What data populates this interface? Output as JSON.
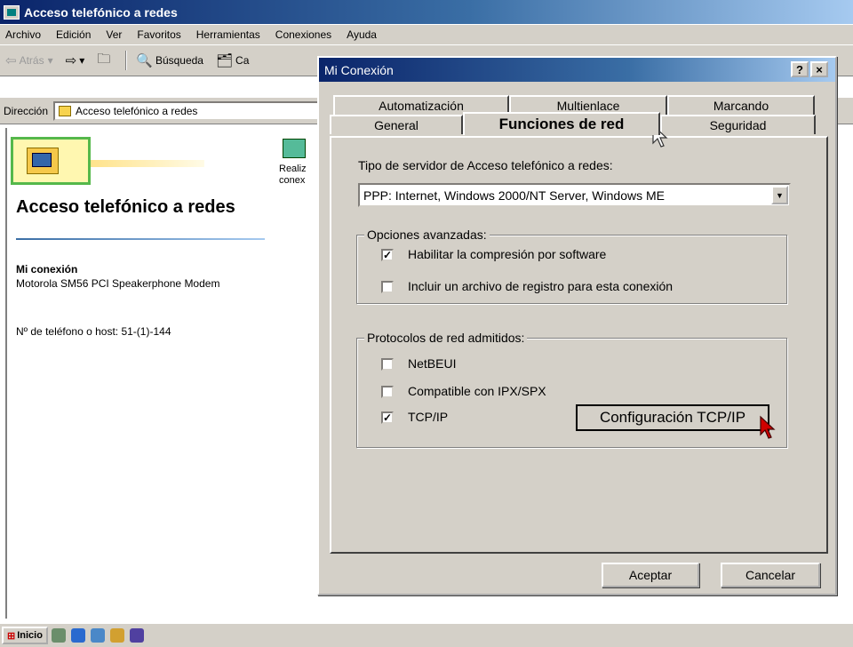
{
  "explorer": {
    "title": "Acceso telefónico a redes",
    "menu": [
      "Archivo",
      "Edición",
      "Ver",
      "Favoritos",
      "Herramientas",
      "Conexiones",
      "Ayuda"
    ],
    "toolbar": {
      "back": "Atrás",
      "search": "Búsqueda",
      "folders": "Ca"
    },
    "address_label": "Dirección",
    "address_value": "Acceso telefónico a redes",
    "side_title": "Acceso telefónico a redes",
    "connection_name": "Mi conexión",
    "modem": "Motorola SM56 PCI Speakerphone Modem",
    "phone": "Nº de teléfono o host: 51-(1)-144",
    "new_connection_text": "Realiz conex"
  },
  "taskbar": {
    "start_label": "Inicio"
  },
  "dialog": {
    "title": "Mi Conexión",
    "help_btn": "?",
    "close_btn": "×",
    "tabs_back": [
      "Automatización",
      "Multienlace",
      "Marcando"
    ],
    "tabs_front": [
      "General",
      "Funciones de red",
      "Seguridad"
    ],
    "active_tab": "Funciones de red",
    "server_type_label": "Tipo de servidor de Acceso telefónico a redes:",
    "server_type_value": "PPP: Internet, Windows 2000/NT Server, Windows ME",
    "advanced_group": "Opciones avanzadas:",
    "adv_compression": "Habilitar la compresión por software",
    "adv_compression_checked": true,
    "adv_log": "Incluir un archivo de registro para esta conexión",
    "adv_log_checked": false,
    "protocols_group": "Protocolos de red admitidos:",
    "proto_netbeui": "NetBEUI",
    "proto_netbeui_checked": false,
    "proto_ipx": "Compatible con IPX/SPX",
    "proto_ipx_checked": false,
    "proto_tcpip": "TCP/IP",
    "proto_tcpip_checked": true,
    "tcpip_config_btn": "Configuración TCP/IP",
    "accept_btn": "Aceptar",
    "cancel_btn": "Cancelar"
  },
  "colors": {
    "titlebar": "#0a246a",
    "face": "#d4d0c8",
    "cursor_red": "#d00000"
  }
}
